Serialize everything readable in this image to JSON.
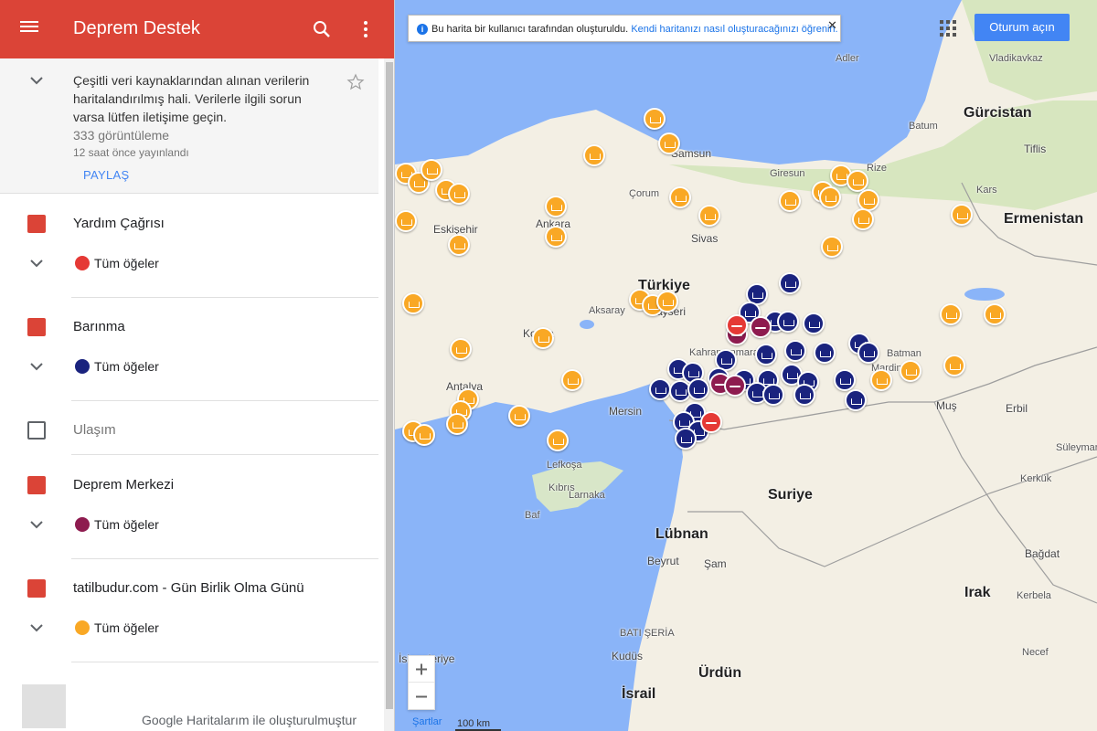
{
  "app": {
    "title": "Deprem Destek"
  },
  "info": {
    "description": "Çeşitli veri kaynaklarından alınan verilerin haritalandırılmış hali. Verilerle ilgili sorun varsa lütfen iletişime geçin.",
    "views": "333 görüntüleme",
    "published": "12 saat önce yayınlandı",
    "share_label": "PAYLAŞ"
  },
  "layers": [
    {
      "name": "Yardım Çağrısı",
      "checked": true,
      "items_label": "Tüm öğeler",
      "icon_color": "#e53935"
    },
    {
      "name": "Barınma",
      "checked": true,
      "items_label": "Tüm öğeler",
      "icon_color": "#1a237e"
    },
    {
      "name": "Ulaşım",
      "checked": false
    },
    {
      "name": "Deprem Merkezi",
      "checked": true,
      "items_label": "Tüm öğeler",
      "icon_color": "#8e1b4f"
    },
    {
      "name": "tatilbudur.com - Gün Birlik Olma Günü",
      "checked": true,
      "items_label": "Tüm öğeler",
      "icon_color": "#f9a825"
    }
  ],
  "footer": {
    "credit": "Google Haritalarım ile oluşturulmuştur"
  },
  "map": {
    "notice_text": "Bu harita bir kullanıcı tarafından oluşturuldu.",
    "notice_link": "Kendi haritanızı nasıl oluşturacağınızı öğrenin.",
    "signin_label": "Oturum açın",
    "terms_label": "Şartlar",
    "scale_label": "100 km",
    "labels": {
      "turkiye": "Türkiye",
      "gurcistan": "Gürcistan",
      "ermenistan": "Ermenistan",
      "suriye": "Suriye",
      "lubnan": "Lübnan",
      "irak": "Irak",
      "kibris": "Kıbrıs",
      "ankara": "Ankara",
      "samsun": "Samsun",
      "sivas": "Sivas",
      "corum": "Çorum",
      "giresun": "Giresun",
      "rize": "Rize",
      "tiflis": "Tiflis",
      "batum": "Batum",
      "kars": "Kars",
      "eskisehir": "Eskişehir",
      "aksaray": "Aksaray",
      "kayseri": "Kayseri",
      "konya": "Konya",
      "antalya": "Antalya",
      "mersin": "Mersin",
      "kahramanmaras": "Kahramanmaraş",
      "batman": "Batman",
      "mardin": "Mardin",
      "mus": "Muş",
      "erbil": "Erbil",
      "suleymaniye": "Süleyman",
      "kerkuk": "Kerkük",
      "bagdat": "Bağdat",
      "kerbela": "Kerbela",
      "necef": "Necef",
      "beyrut": "Beyrut",
      "sam": "Şam",
      "bati_seria": "BATI ŞERİA",
      "kudus": "Kudüs",
      "urdun": "Ürdün",
      "israil": "İsrail",
      "iskenderiye": "İskenderiye",
      "lefkosa": "Lefkoşa",
      "larnaka": "Larnaka",
      "baf": "Baf",
      "vladikavkaz": "Vladikavkaz",
      "adler": "Adler"
    }
  }
}
